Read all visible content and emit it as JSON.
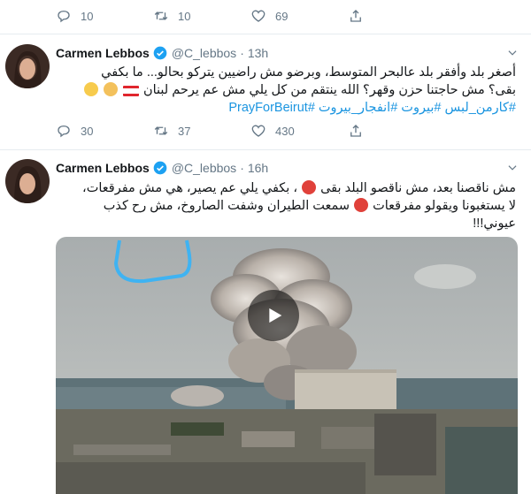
{
  "top_actions": {
    "replies": "10",
    "retweets": "10",
    "likes": "69"
  },
  "tweets": [
    {
      "name": "Carmen Lebbos",
      "handle": "@C_lebbos",
      "dot": "·",
      "time": "13h",
      "text_line1": "أصغر بلد وأفقر بلد عالبحر المتوسط، وبرضو مش راضيين يتركو بحالو... ما بكفي",
      "text_line2": "بقى؟ مش حاجتنا حزن وقهر؟ الله ينتقم من كل يلي مش عم يرحم لبنان",
      "hashtags": "#كارمن_لبس #بيروت #انفجار_بيروت #PrayForBeirut",
      "replies": "30",
      "retweets": "37",
      "likes": "430"
    },
    {
      "name": "Carmen Lebbos",
      "handle": "@C_lebbos",
      "dot": "·",
      "time": "16h",
      "text_line1": "مش ناقصنا بعد، مش ناقصو البلد بقى",
      "text_line1b": "، بكفي يلي عم يصير، هي مش مفرقعات،",
      "text_line2": "لا يستغبونا ويقولو مفرقعات",
      "text_line2b": "سمعت الطيران وشفت الصاروخ، مش رح كذب",
      "text_line3": "عيوني!!!"
    }
  ],
  "icons": [
    "reply-icon",
    "retweet-icon",
    "like-icon",
    "share-icon",
    "verified-icon",
    "caret-icon",
    "play-icon"
  ],
  "colors": {
    "icon": "#657786",
    "link": "#1b95e0",
    "verified": "#1da1f2",
    "separator": "#e6ecf0"
  }
}
